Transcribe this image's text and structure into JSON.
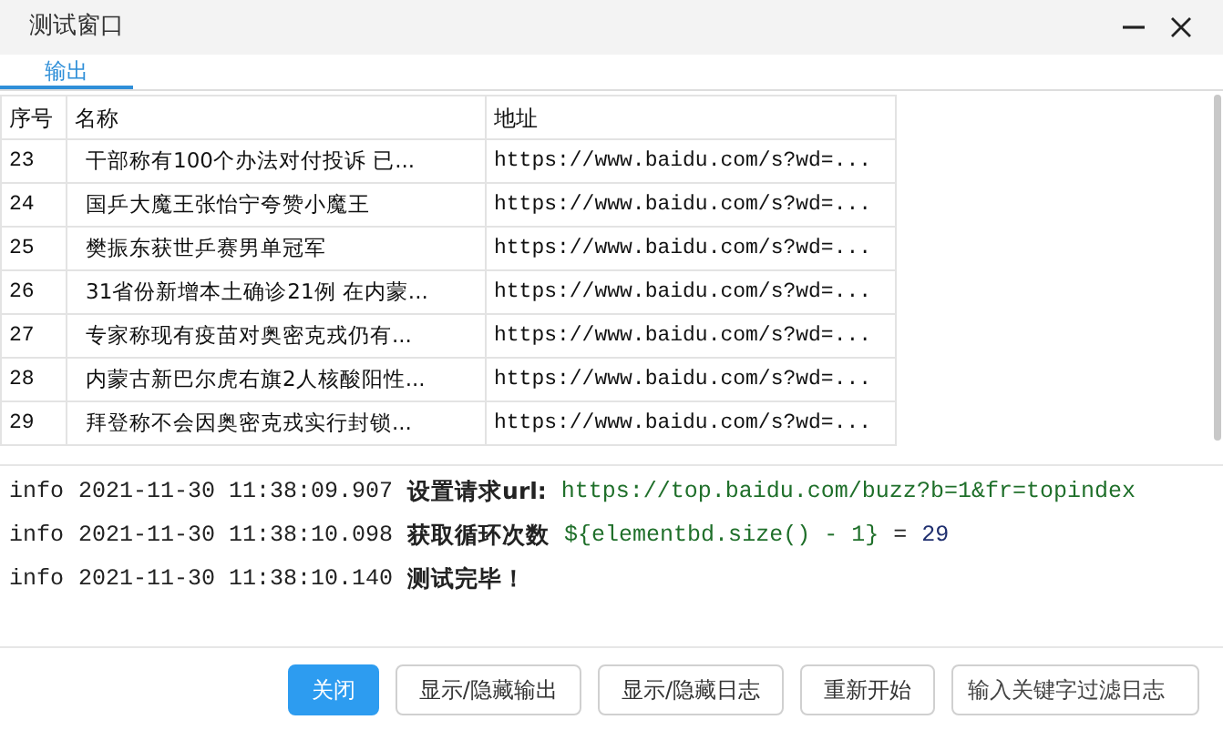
{
  "window": {
    "title": "测试窗口"
  },
  "tabs": [
    {
      "label": "输出",
      "selected": true
    }
  ],
  "table": {
    "columns": [
      "序号",
      "名称",
      "地址"
    ],
    "rows": [
      {
        "cells": [
          "23",
          "干部称有100个办法对付投诉 已...",
          "https://www.baidu.com/s?wd=..."
        ]
      },
      {
        "cells": [
          "24",
          "国乒大魔王张怡宁夸赞小魔王",
          "https://www.baidu.com/s?wd=..."
        ]
      },
      {
        "cells": [
          "25",
          "樊振东获世乒赛男单冠军",
          "https://www.baidu.com/s?wd=..."
        ]
      },
      {
        "cells": [
          "26",
          "31省份新增本土确诊21例 在内蒙...",
          "https://www.baidu.com/s?wd=..."
        ]
      },
      {
        "cells": [
          "27",
          "专家称现有疫苗对奥密克戎仍有...",
          "https://www.baidu.com/s?wd=..."
        ]
      },
      {
        "cells": [
          "28",
          "内蒙古新巴尔虎右旗2人核酸阳性...",
          "https://www.baidu.com/s?wd=..."
        ]
      },
      {
        "cells": [
          "29",
          "拜登称不会因奥密克戎实行封锁...",
          "https://www.baidu.com/s?wd=..."
        ]
      }
    ]
  },
  "log": [
    {
      "level": "info",
      "time": "2021-11-30 11:38:09.907",
      "parts": [
        {
          "kind": "text",
          "text": "设置请求url:"
        },
        {
          "kind": "value",
          "text": "https://top.baidu.com/buzz?b=1&fr=topindex"
        }
      ]
    },
    {
      "level": "info",
      "time": "2021-11-30 11:38:10.098",
      "parts": [
        {
          "kind": "text",
          "text": "获取循环次数"
        },
        {
          "kind": "value",
          "text": "${elementbd.size() - 1}"
        },
        {
          "kind": "operator",
          "text": "="
        },
        {
          "kind": "number",
          "text": "29"
        }
      ]
    },
    {
      "level": "info",
      "time": "2021-11-30 11:38:10.140",
      "parts": [
        {
          "kind": "text",
          "text": "测试完毕！"
        }
      ]
    }
  ],
  "buttons": [
    {
      "label": "关闭",
      "primary": true
    },
    {
      "label": "显示/隐藏输出",
      "primary": false
    },
    {
      "label": "显示/隐藏日志",
      "primary": false
    },
    {
      "label": "重新开始",
      "primary": false
    }
  ],
  "filter": {
    "placeholder": "输入关键字过滤日志"
  }
}
